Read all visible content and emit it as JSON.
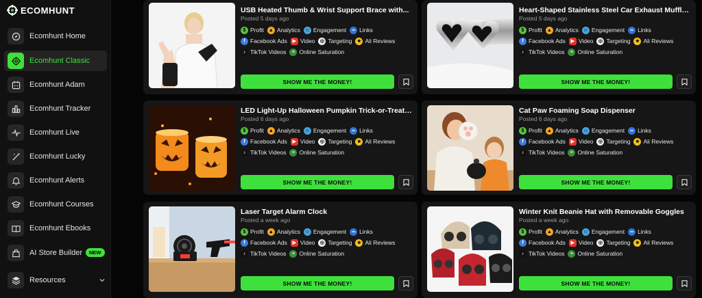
{
  "brand": {
    "name": "ECOMHUNT",
    "accent": "#3ee13b"
  },
  "sidebar": {
    "items": [
      {
        "label": "Ecomhunt Home",
        "icon": "compass-icon"
      },
      {
        "label": "Ecomhunt Classic",
        "icon": "target-icon",
        "active": true
      },
      {
        "label": "Ecomhunt Adam",
        "icon": "calendar-icon"
      },
      {
        "label": "Ecomhunt Tracker",
        "icon": "bar-chart-icon"
      },
      {
        "label": "Ecomhunt Live",
        "icon": "pulse-icon"
      },
      {
        "label": "Ecomhunt Lucky",
        "icon": "magic-wand-icon"
      },
      {
        "label": "Ecomhunt Alerts",
        "icon": "bell-icon"
      },
      {
        "label": "Ecomhunt Courses",
        "icon": "graduation-cap-icon"
      },
      {
        "label": "Ecomhunt Ebooks",
        "icon": "book-icon"
      },
      {
        "label": "AI Store Builder",
        "icon": "shopping-bag-icon",
        "badge": "NEW"
      },
      {
        "label": "Resources",
        "icon": "layers-icon",
        "expandable": true
      }
    ]
  },
  "tag_labels": {
    "profit": "Profit",
    "analytics": "Analytics",
    "engagement": "Engagement",
    "links": "Links",
    "facebook_ads": "Facebook Ads",
    "video": "Video",
    "targeting": "Targeting",
    "ali_reviews": "Ali Reviews",
    "tiktok_videos": "TikTok Videos",
    "online_saturation": "Online Saturation"
  },
  "button_label": "SHOW ME THE MONEY!",
  "products": [
    {
      "title": "USB Heated Thumb & Wrist Support Brace with...",
      "posted": "Posted 5 days ago",
      "image": "wrist-brace-photo"
    },
    {
      "title": "Heart-Shaped Stainless Steel Car Exhaust Muffler Tip",
      "posted": "Posted 5 days ago",
      "image": "exhaust-tip-photo"
    },
    {
      "title": "LED Light-Up Halloween Pumpkin Trick-or-Treat Cand...",
      "posted": "Posted 6 days ago",
      "image": "pumpkin-bucket-photo"
    },
    {
      "title": "Cat Paw Foaming Soap Dispenser",
      "posted": "Posted 6 days ago",
      "image": "soap-dispenser-photo"
    },
    {
      "title": "Laser Target Alarm Clock",
      "posted": "Posted a week ago",
      "image": "alarm-clock-photo"
    },
    {
      "title": "Winter Knit Beanie Hat with Removable Goggles",
      "posted": "Posted a week ago",
      "image": "beanie-hat-photo"
    }
  ]
}
